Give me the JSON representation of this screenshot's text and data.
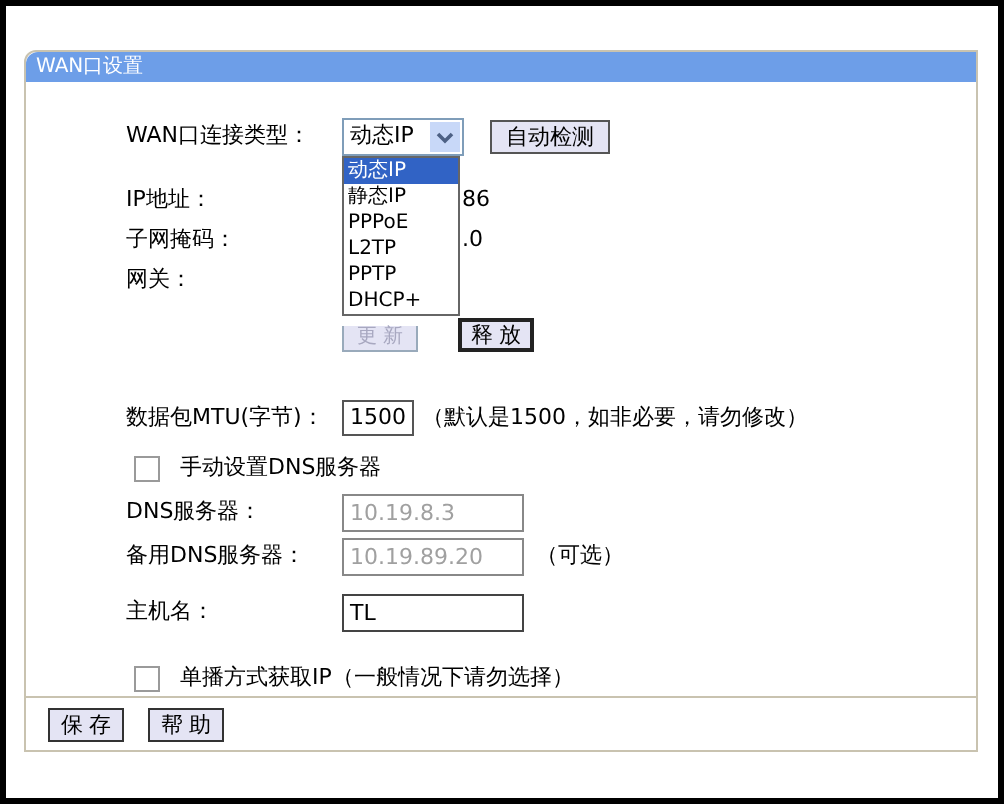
{
  "panel": {
    "title": "WAN口设置"
  },
  "connection_type": {
    "label": "WAN口连接类型：",
    "value": "动态IP",
    "detect_button": "自动检测",
    "options": [
      {
        "label": "动态IP",
        "selected": true
      },
      {
        "label": "静态IP",
        "selected": false
      },
      {
        "label": "PPPoE",
        "selected": false
      },
      {
        "label": "L2TP",
        "selected": false
      },
      {
        "label": "PPTP",
        "selected": false
      },
      {
        "label": "DHCP+",
        "selected": false
      }
    ]
  },
  "info_rows": [
    {
      "label": "IP地址：",
      "value": "86"
    },
    {
      "label": "子网掩码：",
      "value": ".0"
    },
    {
      "label": "网关："
    }
  ],
  "renew_button": {
    "label": "更 新",
    "disabled": true
  },
  "release_button": {
    "label": "释 放",
    "disabled": false
  },
  "mtu": {
    "label": "数据包MTU(字节)：",
    "value": "1500",
    "hint": "（默认是1500，如非必要，请勿修改）"
  },
  "manual_dns": {
    "label": "手动设置DNS服务器",
    "checked": false
  },
  "dns_fields": [
    {
      "label": "DNS服务器：",
      "value": "10.19.8.3",
      "disabled": true
    },
    {
      "label": "备用DNS服务器：",
      "value": "10.19.89.20",
      "disabled": true,
      "note": "（可选）"
    },
    {
      "label": "主机名：",
      "value": "TL",
      "disabled": false
    }
  ],
  "unicast": {
    "label": "单播方式获取IP（一般情况下请勿选择）",
    "checked": false
  },
  "footer_buttons": [
    "保 存",
    "帮 助"
  ]
}
